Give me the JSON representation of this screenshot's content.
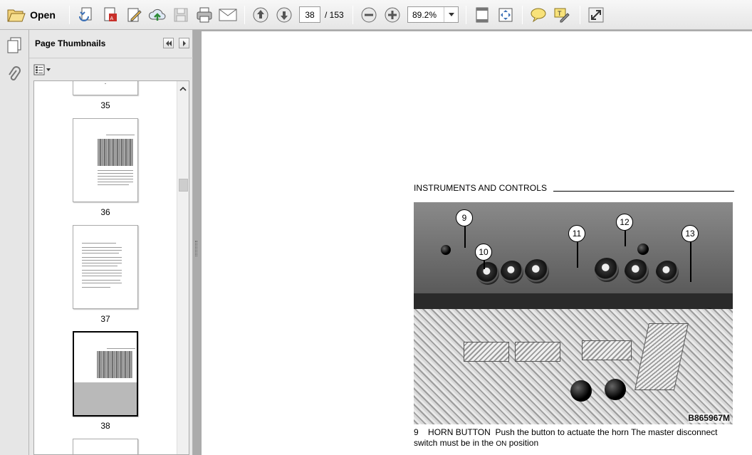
{
  "toolbar": {
    "open_label": "Open",
    "current_page": "38",
    "page_total": "/ 153",
    "zoom_value": "89.2%"
  },
  "panel": {
    "title": "Page Thumbnails"
  },
  "thumbnails": [
    {
      "label": "35"
    },
    {
      "label": "36"
    },
    {
      "label": "37"
    },
    {
      "label": "38"
    }
  ],
  "document": {
    "section_title": "INSTRUMENTS AND CONTROLS",
    "callouts": [
      "9",
      "10",
      "11",
      "12",
      "13"
    ],
    "photo_id": "B865967M",
    "caption_num": "9",
    "caption_heading": "HORN BUTTON",
    "caption_text": "Push the button to actuate the horn  The master disconnect switch must be in the",
    "caption_on": "ON",
    "caption_end": "position"
  },
  "colors": {
    "toolbar_bg": "#eeeeee",
    "workspace_bg": "#ababab",
    "panel_bg": "#e8e8e8",
    "page_bg": "#ffffff"
  }
}
